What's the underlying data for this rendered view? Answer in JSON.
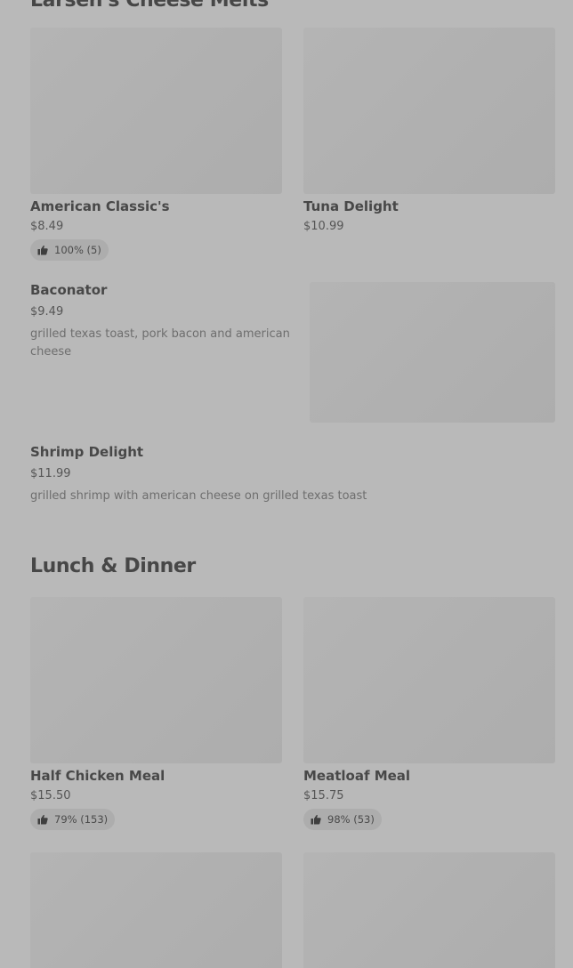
{
  "sections": {
    "cheese_melts": {
      "title": "Larsen's Cheese Melts",
      "items": [
        {
          "name": "American Classic's",
          "price": "$8.49",
          "rating": "100% (5)"
        },
        {
          "name": "Tuna Delight",
          "price": "$10.99"
        },
        {
          "name": "Baconator",
          "price": "$9.49",
          "description": "grilled texas toast, pork bacon and american cheese"
        },
        {
          "name": "Shrimp Delight",
          "price": "$11.99",
          "description": "grilled shrimp with american cheese on grilled texas toast"
        }
      ]
    },
    "lunch_dinner": {
      "title": "Lunch & Dinner",
      "items": [
        {
          "name": "Half Chicken Meal",
          "price": "$15.50",
          "rating": "79% (153)"
        },
        {
          "name": "Meatloaf Meal",
          "price": "$15.75",
          "rating": "98% (53)"
        }
      ]
    }
  },
  "icons": {
    "rating": "thumbs-up-icon"
  },
  "colors": {
    "overlay_background": "#b9b9b9",
    "placeholder": "#b0b0b0",
    "badge": "#adadad"
  }
}
